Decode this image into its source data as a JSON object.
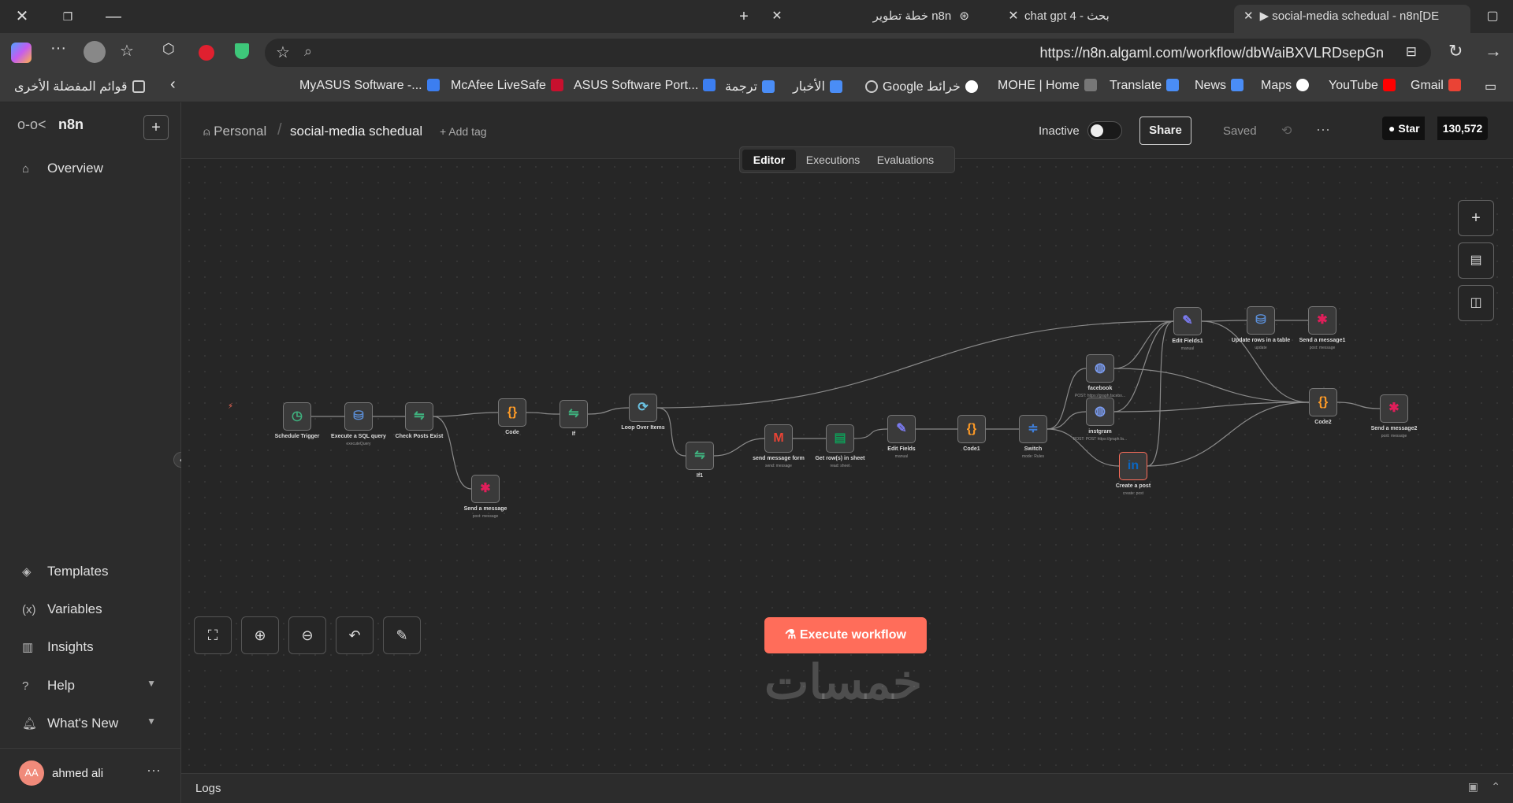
{
  "browser": {
    "tabs": [
      {
        "title": "خطة تطوير n8n"
      },
      {
        "title": "chat gpt 4 - بحث"
      },
      {
        "title": "social-media schedual - n8n[DE"
      }
    ],
    "url": "https://n8n.algaml.com/workflow/dbWaiBXVLRDsepGn",
    "favorites_folder": "قوائم المفضلة الأخرى",
    "bookmarks": [
      "MyASUS Software -...",
      "McAfee LiveSafe",
      "ASUS Software Port...",
      "ترجمة",
      "الأخبار",
      "Google خرائط",
      "MOHE | Home",
      "Translate",
      "News",
      "Maps",
      "YouTube",
      "Gmail"
    ]
  },
  "sidebar": {
    "brand": "n8n",
    "items_top": [
      {
        "label": "Overview",
        "icon": "home-icon"
      }
    ],
    "items_bottom": [
      {
        "label": "Templates",
        "icon": "templates-icon"
      },
      {
        "label": "Variables",
        "icon": "variables-icon"
      },
      {
        "label": "Insights",
        "icon": "insights-icon"
      },
      {
        "label": "Help",
        "icon": "help-icon"
      },
      {
        "label": "What's New",
        "icon": "bell-icon"
      }
    ],
    "user": {
      "initials": "AA",
      "name": "ahmed ali"
    }
  },
  "header": {
    "project": "Personal",
    "workflow_name": "social-media schedual",
    "add_tag": "+ Add tag",
    "status_label": "Inactive",
    "share": "Share",
    "saved": "Saved",
    "star": "Star",
    "star_count": "130,572",
    "tabs": [
      "Editor",
      "Executions",
      "Evaluations"
    ],
    "active_tab": "Editor"
  },
  "workflow": {
    "nodes": [
      {
        "name": "Schedule Trigger",
        "sub": "",
        "icon": "clock-icon",
        "color": "#3fb27f"
      },
      {
        "name": "Execute a SQL query",
        "sub": "executeQuery",
        "icon": "postgres-icon",
        "color": "#5b8ed6"
      },
      {
        "name": "Check Posts Exist",
        "sub": "",
        "icon": "if-icon",
        "color": "#3fb27f"
      },
      {
        "name": "Code",
        "sub": "",
        "icon": "code-icon",
        "color": "#ff9b26"
      },
      {
        "name": "If",
        "sub": "",
        "icon": "if-icon",
        "color": "#3fb27f"
      },
      {
        "name": "Loop Over Items",
        "sub": "",
        "icon": "loop-icon",
        "color": "#6ac0e0"
      },
      {
        "name": "If1",
        "sub": "",
        "icon": "if-icon",
        "color": "#3fb27f"
      },
      {
        "name": "Send a message",
        "sub": "post: message",
        "icon": "slack-icon",
        "color": "#e01e5a"
      },
      {
        "name": "send message form",
        "sub": "send: message",
        "icon": "gmail-icon",
        "color": "#ea4335"
      },
      {
        "name": "Get row(s) in sheet",
        "sub": "read: sheet",
        "icon": "sheets-icon",
        "color": "#0f9d58"
      },
      {
        "name": "Edit Fields",
        "sub": "manual",
        "icon": "pencil-icon",
        "color": "#7b7bf0"
      },
      {
        "name": "Code1",
        "sub": "",
        "icon": "code-icon",
        "color": "#ff9b26"
      },
      {
        "name": "Switch",
        "sub": "mode: Rules",
        "icon": "switch-icon",
        "color": "#3f7ed8"
      },
      {
        "name": "facebook",
        "sub": "POST: https://graph.facebo...",
        "icon": "globe-icon",
        "color": "#7b9cf0"
      },
      {
        "name": "instgram",
        "sub": "POST: POST https://graph.fa...",
        "icon": "globe-icon",
        "color": "#7b9cf0"
      },
      {
        "name": "Create a post",
        "sub": "create: post",
        "icon": "linkedin-icon",
        "color": "#0a66c2"
      },
      {
        "name": "Edit Fields1",
        "sub": "manual",
        "icon": "pencil-icon",
        "color": "#7b7bf0"
      },
      {
        "name": "Update rows in a table",
        "sub": "update",
        "icon": "postgres-icon",
        "color": "#5b8ed6"
      },
      {
        "name": "Send a message1",
        "sub": "post: message",
        "icon": "slack-icon",
        "color": "#e01e5a"
      },
      {
        "name": "Code2",
        "sub": "",
        "icon": "code-icon",
        "color": "#ff9b26"
      },
      {
        "name": "Send a message2",
        "sub": "post: message",
        "icon": "slack-icon",
        "color": "#e01e5a"
      }
    ],
    "branch_labels": {
      "true": "true",
      "false": "false",
      "facebook": "facebook",
      "instgram": "instgram",
      "linkedin": "linkedin"
    }
  },
  "execute_button": "Execute workflow",
  "logs_label": "Logs",
  "watermark": "خمسات",
  "colors": {
    "accent": "#ff6d5a",
    "node_bg": "#3a3a3a",
    "canvas_bg": "#262626"
  }
}
